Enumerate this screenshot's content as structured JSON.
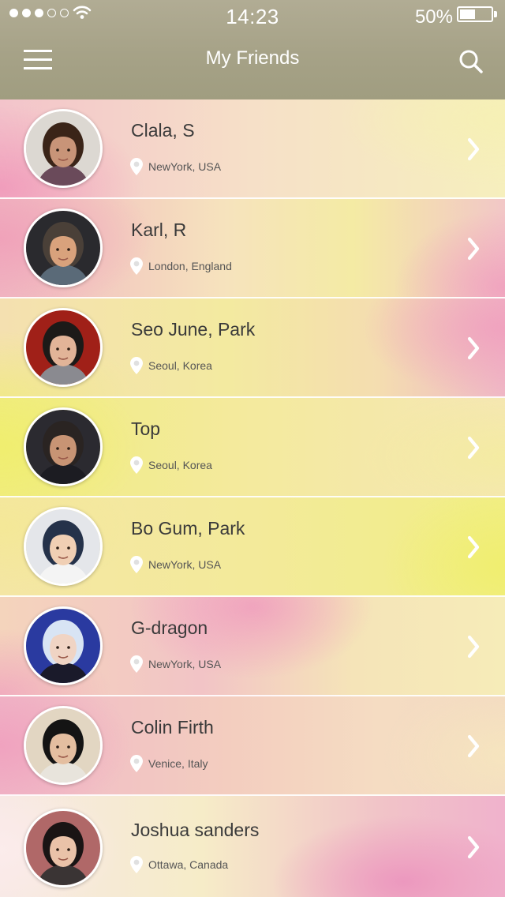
{
  "status_bar": {
    "time": "14:23",
    "battery": "50%",
    "battery_level": 0.5,
    "signal_bars_filled": 3,
    "signal_bars_total": 5,
    "wifi_icon": "wifi-icon"
  },
  "nav": {
    "title": "My Friends",
    "menu_icon": "hamburger-menu-icon",
    "search_icon": "search-icon"
  },
  "friends": [
    {
      "name": "Clala, S",
      "location": "NewYork, USA"
    },
    {
      "name": "Karl, R",
      "location": "London, England"
    },
    {
      "name": "Seo June, Park",
      "location": "Seoul, Korea"
    },
    {
      "name": "Top",
      "location": "Seoul, Korea"
    },
    {
      "name": "Bo Gum, Park",
      "location": "NewYork, USA"
    },
    {
      "name": "G-dragon",
      "location": "NewYork, USA"
    },
    {
      "name": "Colin Firth",
      "location": "Venice, Italy"
    },
    {
      "name": "Joshua sanders",
      "location": "Ottawa, Canada"
    }
  ],
  "icons": {
    "location": "map-pin-icon",
    "row_action": "chevron-right-icon"
  },
  "colors": {
    "header": "#a6a287",
    "gradient_pink": "#f0a8c2",
    "gradient_yellow": "#f1ef7a",
    "gradient_cream": "#f6ecc0",
    "text_primary": "#3a3a3a",
    "text_secondary": "#555555"
  }
}
